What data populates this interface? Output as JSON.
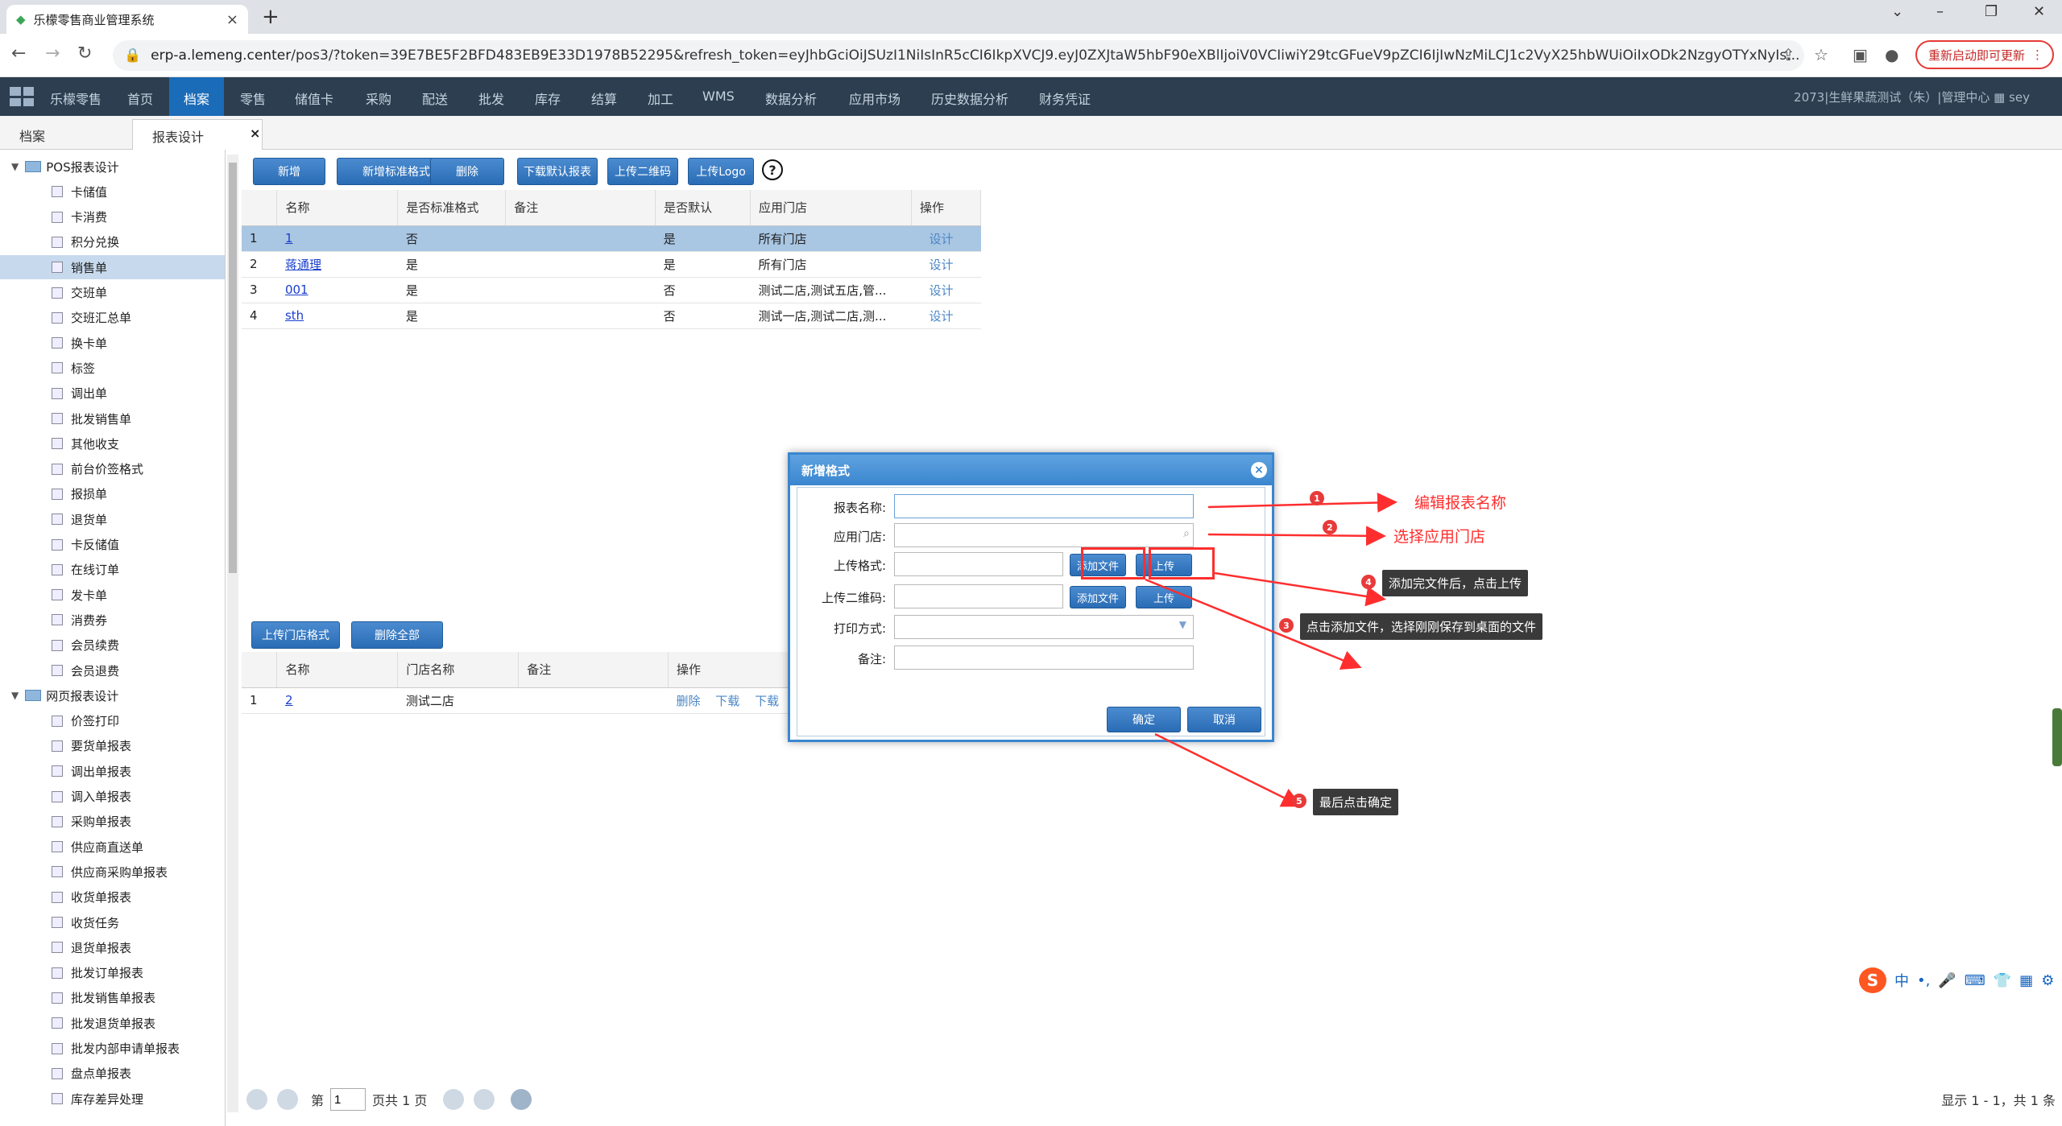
{
  "browser": {
    "tab_title": "乐檬零售商业管理系统",
    "url_host": "erp-a.lemeng.center",
    "url_rest": "/pos3/?token=39E7BE5F2BFD483EB9E33D1978B52295&refresh_token=eyJhbGciOiJSUzI1NiIsInR5cCI6IkpXVCJ9.eyJ0ZXJtaW5hbF90eXBlIjoiV0VCIiwiY29tcGFueV9pZCI6IjIwNzMiLCJ1c2VyX25hbWUiOiIxODk2NzgyOTYxNyIs...",
    "update_label": "重新启动即可更新"
  },
  "appnav": {
    "brand": "乐檬零售",
    "items": [
      "首页",
      "档案",
      "零售",
      "储值卡",
      "采购",
      "配送",
      "批发",
      "库存",
      "结算",
      "加工",
      "WMS",
      "数据分析",
      "应用市场",
      "历史数据分析",
      "财务凭证"
    ],
    "active": "档案",
    "right": "2073|生鲜果蔬测试（朱）|管理中心",
    "user": "sey"
  },
  "subtabs": {
    "tab1": "档案",
    "tab2": "报表设计"
  },
  "tree": {
    "group1": "POS报表设计",
    "group1_items": [
      "卡储值",
      "卡消费",
      "积分兑换",
      "销售单",
      "交班单",
      "交班汇总单",
      "换卡单",
      "标签",
      "调出单",
      "批发销售单",
      "其他收支",
      "前台价签格式",
      "报损单",
      "退货单",
      "卡反储值",
      "在线订单",
      "发卡单",
      "消费券",
      "会员续费",
      "会员退费"
    ],
    "selected": "销售单",
    "group2": "网页报表设计",
    "group2_items": [
      "价签打印",
      "要货单报表",
      "调出单报表",
      "调入单报表",
      "采购单报表",
      "供应商直送单",
      "供应商采购单报表",
      "收货单报表",
      "收货任务",
      "退货单报表",
      "批发订单报表",
      "批发销售单报表",
      "批发退货单报表",
      "批发内部申请单报表",
      "盘点单报表",
      "库存差异处理"
    ]
  },
  "toolbar": {
    "add": "新增",
    "add_std": "新增标准格式",
    "del": "删除",
    "download": "下载默认报表",
    "upload_qr": "上传二维码",
    "upload_logo": "上传Logo",
    "help": "?"
  },
  "grid1": {
    "headers": [
      "名称",
      "是否标准格式",
      "备注",
      "是否默认",
      "应用门店",
      "操作"
    ],
    "rows": [
      {
        "no": "1",
        "name": "1",
        "std": "否",
        "note": "",
        "def": "是",
        "store": "所有门店",
        "op": "设计"
      },
      {
        "no": "2",
        "name": "蒋通理",
        "std": "是",
        "note": "",
        "def": "是",
        "store": "所有门店",
        "op": "设计"
      },
      {
        "no": "3",
        "name": "001",
        "std": "是",
        "note": "",
        "def": "否",
        "store": "测试二店,测试五店,管...",
        "op": "设计"
      },
      {
        "no": "4",
        "name": "sth",
        "std": "是",
        "note": "",
        "def": "否",
        "store": "测试一店,测试二店,测...",
        "op": "设计"
      }
    ]
  },
  "toolbar2": {
    "upload_store": "上传门店格式",
    "del_all": "删除全部"
  },
  "grid2": {
    "headers": [
      "名称",
      "门店名称",
      "备注",
      "操作"
    ],
    "rows": [
      {
        "no": "1",
        "name": "2",
        "store": "测试二店",
        "note": "",
        "op1": "删除",
        "op2": "下载",
        "op3": "下载"
      }
    ]
  },
  "pager": {
    "page_prefix": "第",
    "page_value": "1",
    "page_suffix": "页共 1 页",
    "info": "显示 1 - 1，共 1 条"
  },
  "dialog": {
    "title": "新增格式",
    "label_name": "报表名称:",
    "label_store": "应用门店:",
    "label_format": "上传格式:",
    "label_qr": "上传二维码:",
    "label_print": "打印方式:",
    "label_note": "备注:",
    "add_file": "添加文件",
    "upload": "上传",
    "ok": "确定",
    "cancel": "取消"
  },
  "annotations": {
    "a1": "编辑报表名称",
    "a2": "选择应用门店",
    "a3": "点击添加文件，选择刚刚保存到桌面的文件",
    "a4": "添加完文件后，点击上传",
    "a5": "最后点击确定",
    "n1": "1",
    "n2": "2",
    "n3": "3",
    "n4": "4",
    "n5": "5",
    "annotation_color": "#ff2e2e"
  },
  "ime": {
    "label": "中"
  }
}
